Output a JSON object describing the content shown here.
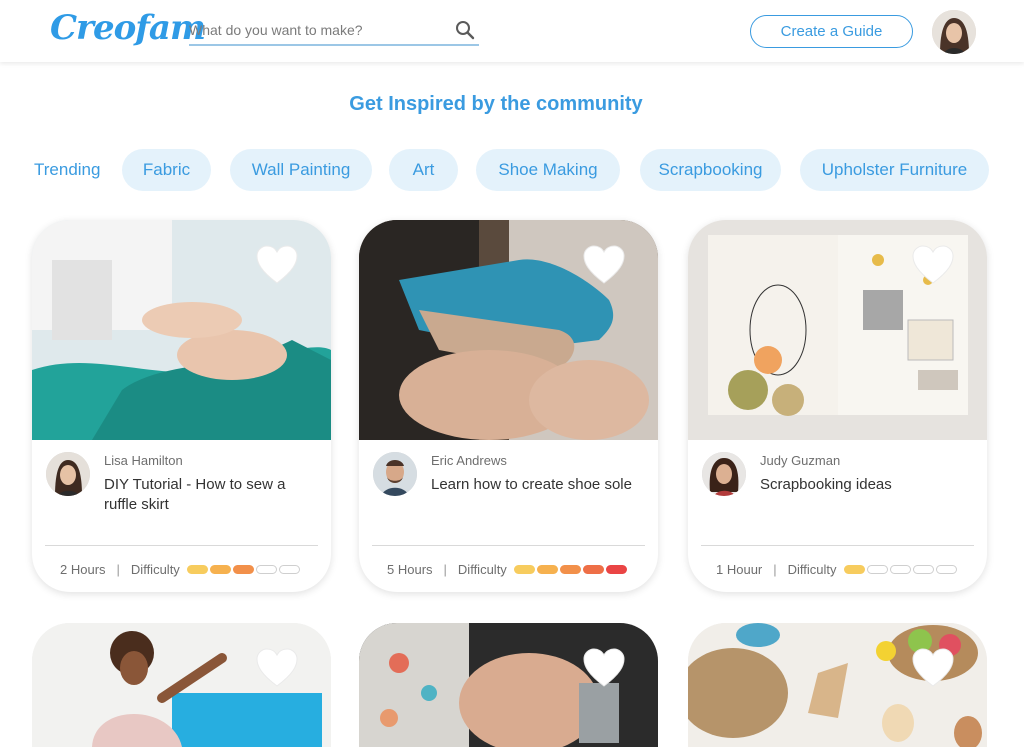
{
  "app": {
    "logo": "Creofam",
    "search_placeholder": "What do you want to make?",
    "create_button": "Create a Guide"
  },
  "page": {
    "title": "Get Inspired by the community",
    "trending_label": "Trending",
    "chips": [
      "Fabric",
      "Wall Painting",
      "Art",
      "Shoe Making",
      "Scrapbooking",
      "Upholster Furniture"
    ]
  },
  "cards": [
    {
      "author": "Lisa Hamilton",
      "title": "DIY Tutorial - How to sew a ruffle skirt",
      "duration": "2 Hours",
      "difficulty_label": "Difficulty",
      "difficulty_level": 3,
      "difficulty_max": 5
    },
    {
      "author": "Eric Andrews",
      "title": "Learn how to create shoe sole",
      "duration": "5 Hours",
      "difficulty_label": "Difficulty",
      "difficulty_level": 5,
      "difficulty_max": 5
    },
    {
      "author": "Judy Guzman",
      "title": "Scrapbooking ideas",
      "duration": "1 Houur",
      "difficulty_label": "Difficulty",
      "difficulty_level": 1,
      "difficulty_max": 5
    }
  ],
  "colors": {
    "accent": "#3a9be0",
    "chip_bg": "#e4f2fb",
    "difficulty": [
      "#f7cc5e",
      "#f6b14f",
      "#f2904a",
      "#ee6f47",
      "#ea4545"
    ]
  },
  "icons": [
    "search-icon",
    "heart-icon"
  ]
}
